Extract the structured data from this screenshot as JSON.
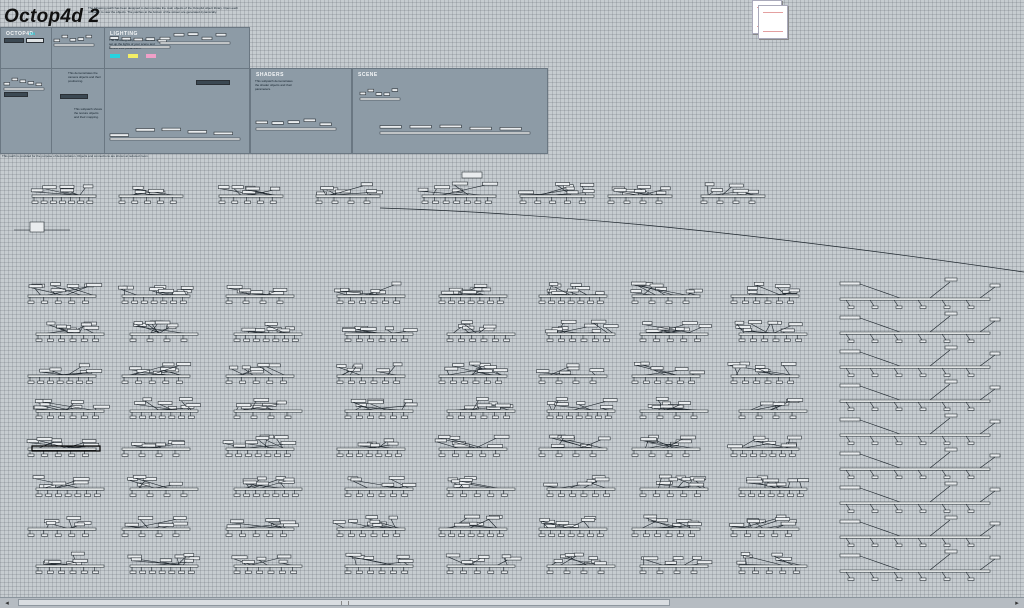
{
  "app": {
    "title": "Octop4d 2"
  },
  "intro_note": "The following patch has been designed to demonstrate the main objects of the Octop4d object library. Open each subpatch to view the objects. The patches at the bottom of the screen are generated dynamically.",
  "sections": {
    "octop4d": {
      "header": "OCTOP4D",
      "tag": "ON"
    },
    "lighting": {
      "header": "LIGHTING",
      "note": "The following subpatch shows how to set up the lights of your scene and control their parameters."
    },
    "shaders": {
      "header": "SHADERS",
      "note": "This subpatch demonstrates the shader objects and their parameters."
    },
    "scene": {
      "header": "SCENE"
    },
    "controls": {
      "note_a": "This demonstrates the camera objects and their positioning.",
      "note_b": "This subpatch shows the texture objects and their mapping."
    }
  },
  "status_note": "This patch is provided for the purpose of demonstration. Objects and connections are shown at reduced zoom.",
  "colors": {
    "background": "#c6ccd0",
    "grid": "#5a646c",
    "panel": "#8d9ba6",
    "object_box": "#e9ecee",
    "object_border": "#2b3238",
    "patch_cord": "#1c242b",
    "accent_cyan": "#27d3e0",
    "accent_yellow": "#f4ee66",
    "accent_pink": "#f0a0c8"
  },
  "icons": {
    "scroll_left": "◂",
    "scroll_right": "▸",
    "page_icon": "document-stack-icon"
  }
}
